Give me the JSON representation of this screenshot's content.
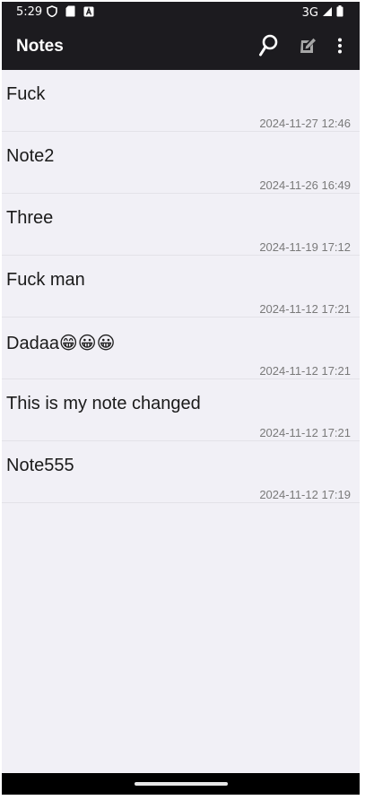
{
  "status_bar": {
    "time": "5:29",
    "network": "3G",
    "icons": [
      "shield-icon",
      "sd-card-icon",
      "font-a-icon",
      "signal-icon",
      "battery-icon"
    ]
  },
  "app_bar": {
    "title": "Notes",
    "actions": [
      "search-icon",
      "new-note-icon",
      "more-vert-icon"
    ]
  },
  "notes": [
    {
      "title": "Fuck",
      "date": "2024-11-27 12:46"
    },
    {
      "title": "Note2",
      "date": "2024-11-26 16:49"
    },
    {
      "title": "Three",
      "date": "2024-11-19 17:12"
    },
    {
      "title": "Fuck man",
      "date": "2024-11-12 17:21"
    },
    {
      "title": "Dadaa😁😀😀",
      "date": "2024-11-12 17:21"
    },
    {
      "title": "This is my note changed",
      "date": "2024-11-12 17:21"
    },
    {
      "title": "Note555",
      "date": "2024-11-12 17:19"
    }
  ],
  "colors": {
    "app_bar_bg": "#1c1b1f",
    "list_bg": "#f1f0f6",
    "title_text": "#1a1a1a",
    "date_text": "#7a7a7a"
  }
}
